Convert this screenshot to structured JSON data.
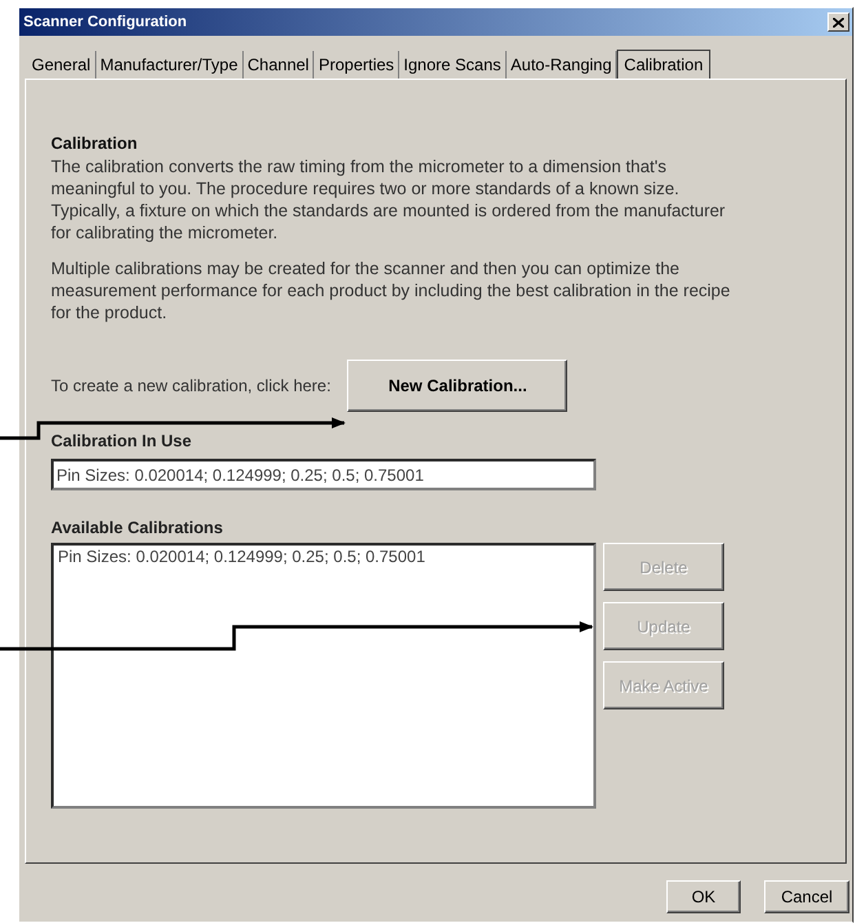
{
  "window": {
    "title": "Scanner Configuration"
  },
  "tabs": [
    {
      "label": "General",
      "selected": false
    },
    {
      "label": "Manufacturer/Type",
      "selected": false
    },
    {
      "label": "Channel",
      "selected": false
    },
    {
      "label": "Properties",
      "selected": false
    },
    {
      "label": "Ignore Scans",
      "selected": false
    },
    {
      "label": "Auto-Ranging",
      "selected": false
    },
    {
      "label": "Calibration",
      "selected": true
    }
  ],
  "section_title": "Calibration",
  "paragraphs": [
    "The calibration converts the raw timing from the micrometer to a dimension that's meaningful to you. The procedure requires two or more standards of a known size. Typically, a fixture on which the standards are mounted is ordered from the manufacturer for calibrating the micrometer.",
    "Multiple calibrations may be created for the scanner and then you can optimize the measurement performance for each product by including the best calibration in the recipe for the product."
  ],
  "create_prompt": "To create a new calibration, click here:",
  "new_button": "New Calibration...",
  "in_use": {
    "label": "Calibration In Use",
    "value": "Pin Sizes: 0.020014; 0.124999; 0.25; 0.5; 0.75001"
  },
  "available": {
    "label": "Available Calibrations",
    "items": [
      "Pin Sizes: 0.020014; 0.124999; 0.25; 0.5; 0.75001"
    ]
  },
  "side_buttons": [
    {
      "label": "Delete",
      "disabled": true
    },
    {
      "label": "Update",
      "disabled": true
    },
    {
      "label": "Make Active",
      "disabled": true
    }
  ],
  "footer_buttons": [
    {
      "label": "OK",
      "disabled": false
    },
    {
      "label": "Cancel",
      "disabled": false
    }
  ]
}
